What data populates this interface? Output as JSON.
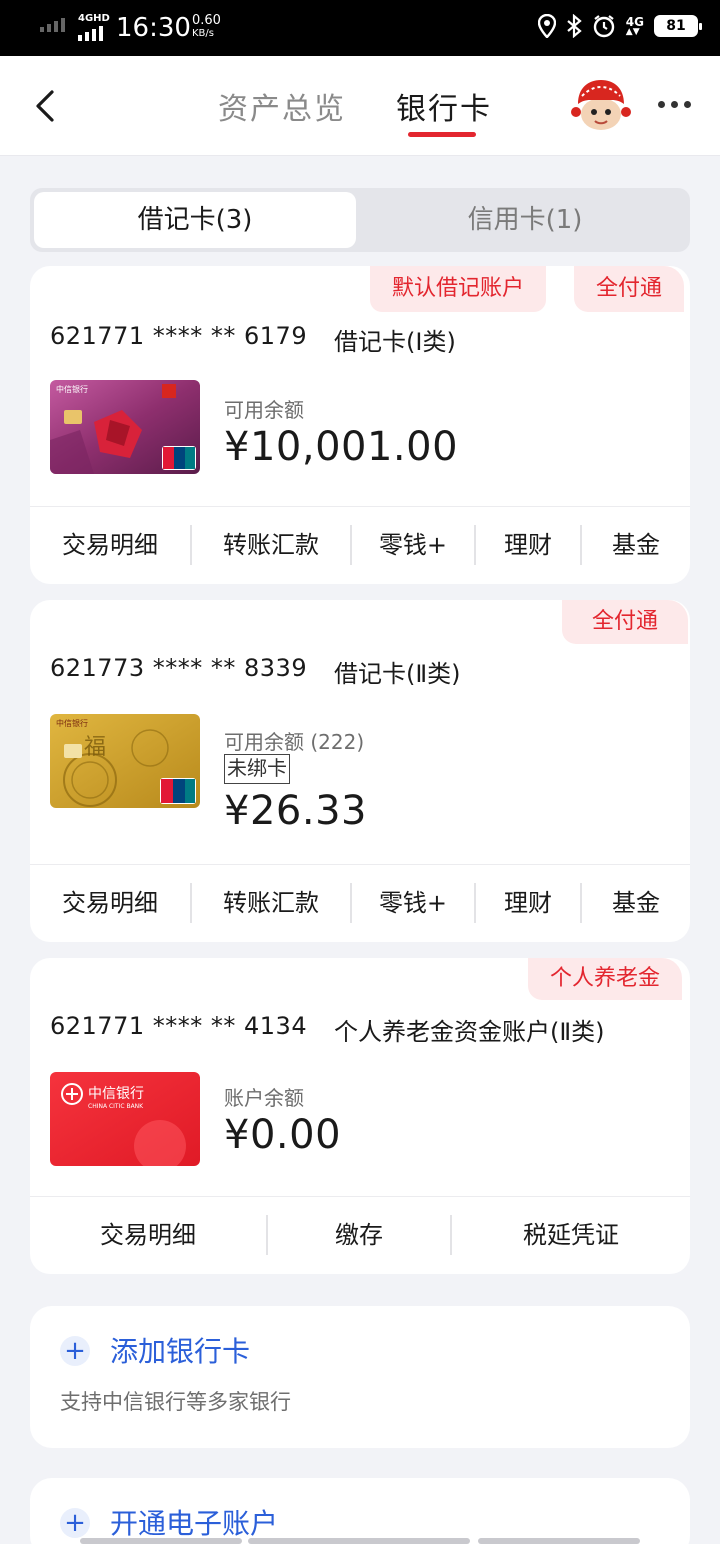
{
  "status_bar": {
    "network": "4GHD",
    "time": "16:30",
    "speed_value": "0.60",
    "speed_unit": "KB/s",
    "net_right": "4G",
    "battery": "81"
  },
  "header": {
    "tab_overview": "资产总览",
    "tab_bankcard": "银行卡"
  },
  "segment": {
    "debit_label": "借记卡(3)",
    "credit_label": "信用卡(1)"
  },
  "cards": [
    {
      "badges": [
        "默认借记账户",
        "全付通"
      ],
      "number": "621771 **** ** 6179",
      "type": "借记卡(Ⅰ类)",
      "balance_label": "可用余额",
      "balance": "¥10,001.00",
      "actions": [
        "交易明细",
        "转账汇款",
        "零钱+",
        "理财",
        "基金"
      ]
    },
    {
      "badges": [
        "全付通"
      ],
      "number": "621773 **** ** 8339",
      "type": "借记卡(Ⅱ类)",
      "balance_label": "可用余额",
      "balance_count": "(222)",
      "unbound": "未绑卡",
      "balance": "¥26.33",
      "actions": [
        "交易明细",
        "转账汇款",
        "零钱+",
        "理财",
        "基金"
      ]
    },
    {
      "badges": [
        "个人养老金"
      ],
      "number": "621771 **** ** 4134",
      "type": "个人养老金资金账户(Ⅱ类)",
      "balance_label": "账户余额",
      "balance": "¥0.00",
      "actions": [
        "交易明细",
        "缴存",
        "税延凭证"
      ]
    }
  ],
  "card_art": {
    "bank_name": "中信银行",
    "bank_name_en": "CHINA CITIC BANK",
    "unionpay": "UnionPay",
    "unionpay_cn": "银联"
  },
  "add_bank": {
    "title": "添加银行卡",
    "subtitle": "支持中信银行等多家银行"
  },
  "open_eaccount": {
    "title": "开通电子账户"
  },
  "colors": {
    "accent_red": "#e3262f",
    "badge_bg": "#fde9ea",
    "link_blue": "#2b5fd9",
    "page_bg": "#f2f3f7"
  }
}
